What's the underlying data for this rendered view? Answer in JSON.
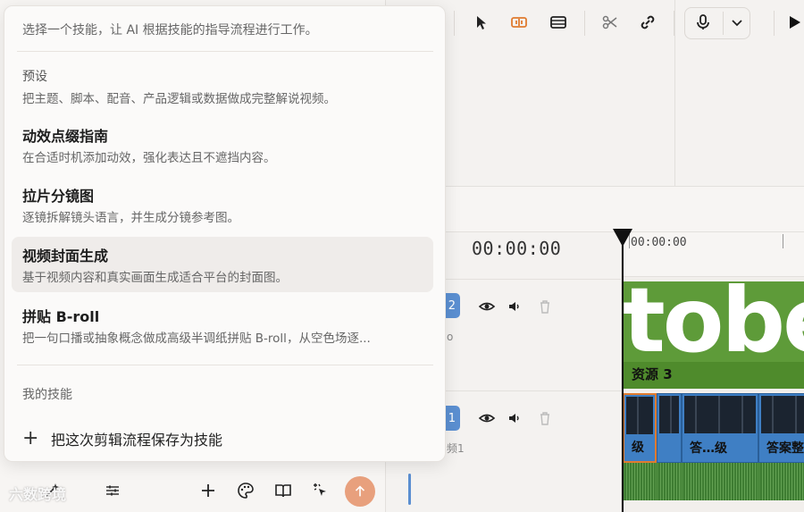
{
  "popup": {
    "intro": "选择一个技能，让 AI 根据技能的指导流程进行工作。",
    "preset_label": "预设",
    "items": [
      {
        "title": "",
        "desc": "把主题、脚本、配音、产品逻辑或数据做成完整解说视频。"
      },
      {
        "title": "动效点缀指南",
        "desc": "在合适时机添加动效，强化表达且不遮挡内容。"
      },
      {
        "title": "拉片分镜图",
        "desc": "逐镜拆解镜头语言，并生成分镜参考图。"
      },
      {
        "title": "视频封面生成",
        "desc": "基于视频内容和真实画面生成适合平台的封面图。"
      },
      {
        "title": "拼贴 B-roll",
        "desc": "把一句口播或抽象概念做成高级半调纸拼贴 B-roll，从空色场逐..."
      }
    ],
    "my_skills_label": "我的技能",
    "save_skill_label": "把这次剪辑流程保存为技能",
    "highlighted_index": 3
  },
  "timeline": {
    "timecode": "00:00:00",
    "ruler_labels": [
      "00:00:00"
    ],
    "tracks": [
      {
        "badge": "2",
        "sub": "o"
      },
      {
        "badge": "1",
        "sub": "频1"
      }
    ],
    "title_clip": {
      "text": "tobe",
      "label": "资源 3"
    },
    "clips": [
      {
        "label": "级",
        "selected": true
      },
      {
        "label": "",
        "selected": false
      },
      {
        "label": "答…级",
        "selected": false
      },
      {
        "label": "答案整",
        "selected": false
      }
    ]
  },
  "toolbar": {
    "icons": [
      "pointer-icon",
      "split-audio-icon",
      "film-icon",
      "scissors-icon",
      "link-icon",
      "mic-icon",
      "chevron-down-icon",
      "play-icon"
    ]
  },
  "bottom_bar": {
    "icons": [
      "magic-wand-icon",
      "sliders-icon",
      "plus-icon",
      "palette-icon",
      "book-icon",
      "sparkle-cursor-icon",
      "send-icon"
    ]
  },
  "watermark": "六数跨境",
  "colors": {
    "accent_orange": "#e8a07d",
    "track_blue": "#3f7fc4",
    "title_green": "#5e9b39",
    "selection_orange": "#e07b2f"
  }
}
